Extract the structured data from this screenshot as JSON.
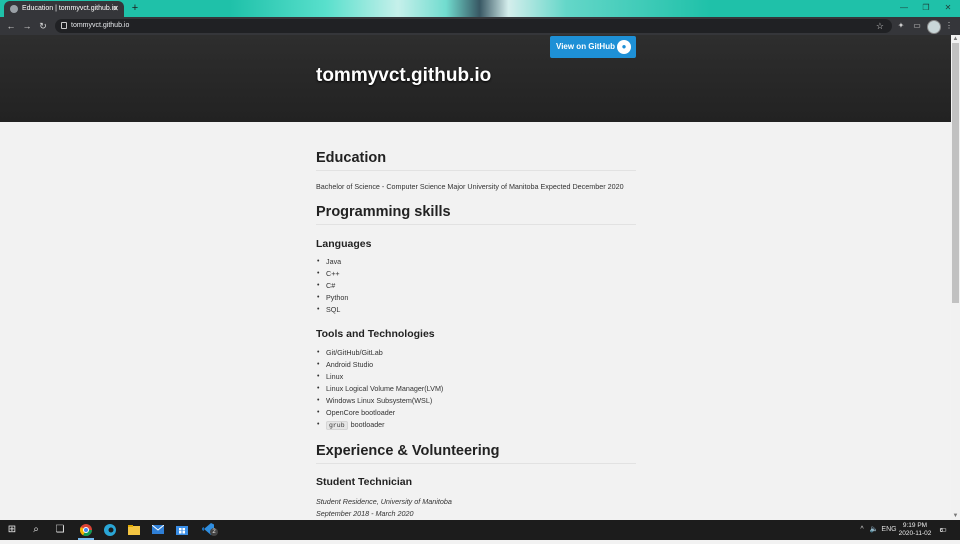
{
  "browser": {
    "tab_title": "Education | tommyvct.github.io",
    "tab_close": "✕",
    "new_tab": "+",
    "url": "tommyvct.github.io",
    "window_controls": {
      "minimize": "—",
      "maximize": "❐",
      "close": "✕"
    },
    "nav": {
      "back": "←",
      "forward": "→",
      "reload": "↻"
    },
    "toolbar_icons": {
      "star": "☆",
      "extensions": "✦",
      "cast": "▭",
      "menu": "⋮"
    }
  },
  "header": {
    "github_button": "View on GitHub",
    "site_title": "tommyvct.github.io"
  },
  "content": {
    "education": {
      "heading": "Education",
      "text": "Bachelor of Science - Computer Science Major University of Manitoba Expected December 2020"
    },
    "skills": {
      "heading": "Programming skills",
      "languages_heading": "Languages",
      "languages": [
        "Java",
        "C++",
        "C#",
        "Python",
        "SQL"
      ],
      "tools_heading": "Tools and Technologies",
      "tools": [
        "Git/GitHub/GitLab",
        "Android Studio",
        "Linux",
        "Linux Logical Volume Manager(LVM)",
        "Windows Linux Subsystem(WSL)",
        "OpenCore bootloader"
      ],
      "grub_code": "grub",
      "grub_text": "bootloader"
    },
    "experience": {
      "heading": "Experience & Volunteering",
      "job_title": "Student Technician",
      "org": "Student Residence, University of Manitoba",
      "dates": "September 2018 - March 2020"
    }
  },
  "taskbar": {
    "start": "⊞",
    "search": "⌕",
    "taskview": "❏",
    "edge_badge": "2",
    "tray_chevron": "^",
    "volume": "🔈",
    "language": "ENG",
    "time": "9:19 PM",
    "date": "2020-11-02",
    "notification_count": "8"
  }
}
